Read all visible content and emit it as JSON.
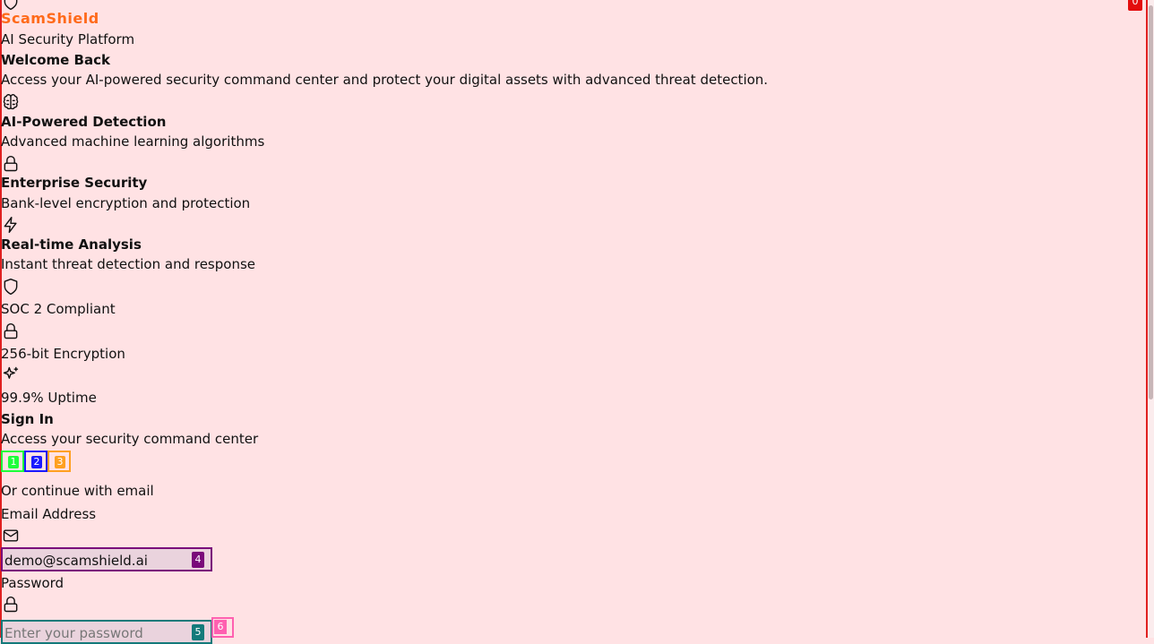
{
  "brand": {
    "name": "ScamShield",
    "tagline": "AI Security Platform"
  },
  "hero": {
    "title": "Welcome Back",
    "subtitle": "Access your AI-powered security command center and protect your digital assets with advanced threat detection."
  },
  "features": [
    {
      "icon": "brain-icon",
      "title": "AI-Powered Detection",
      "desc": "Advanced machine learning algorithms"
    },
    {
      "icon": "lock-icon",
      "title": "Enterprise Security",
      "desc": "Bank-level encryption and protection"
    },
    {
      "icon": "zap-icon",
      "title": "Real-time Analysis",
      "desc": "Instant threat detection and response"
    }
  ],
  "badges": [
    {
      "icon": "shield-icon",
      "label": "SOC 2 Compliant"
    },
    {
      "icon": "lock-icon",
      "label": "256-bit Encryption"
    },
    {
      "icon": "sparkles-icon",
      "label": "99.9% Uptime"
    }
  ],
  "signin": {
    "title": "Sign In",
    "subtitle": "Access your security command center",
    "social_buttons": [
      "1",
      "2",
      "3"
    ],
    "divider": "Or continue with email",
    "email_label": "Email Address",
    "email_value": "demo@scamshield.ai",
    "email_marker": "4",
    "password_label": "Password",
    "password_placeholder": "Enter your password",
    "password_marker": "5",
    "toggle_marker": "6"
  },
  "corner_marker": "0",
  "colors": {
    "background": "#ffe2e4",
    "brand": "#ff6a1a",
    "marker_red": "#e30d0d"
  }
}
